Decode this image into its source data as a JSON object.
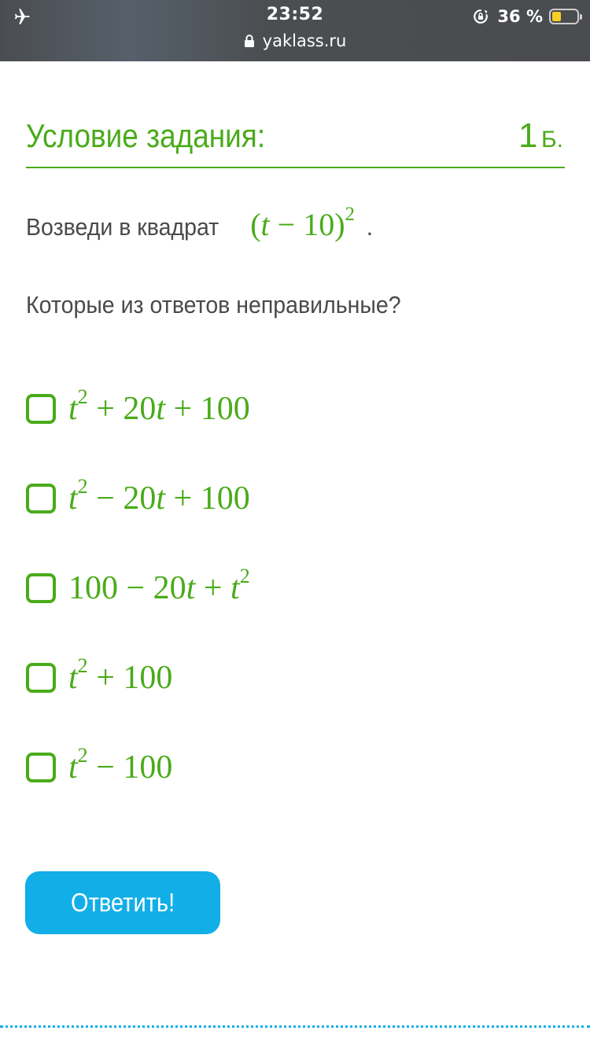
{
  "status_bar": {
    "time": "23:52",
    "battery_percent": "36 %",
    "battery_level": 0.36,
    "url": "yaklass.ru",
    "icons": [
      "airplane-icon",
      "rotation-lock-icon",
      "battery-icon",
      "padlock-icon"
    ]
  },
  "task": {
    "title": "Условие задания:",
    "points_value": "1",
    "points_unit": "Б."
  },
  "question": {
    "prompt": "Возведи в квадрат",
    "expression": {
      "open": "(",
      "var": "t",
      "rest": " − 10)",
      "power": "2"
    },
    "dot": ".",
    "instruction": "Которые из ответов неправильные?"
  },
  "options": [
    {
      "parts": [
        "t",
        "2",
        " + 20",
        "t",
        " + 100"
      ]
    },
    {
      "parts": [
        "t",
        "2",
        " − 20",
        "t",
        " + 100"
      ]
    },
    {
      "prefix": "100 − 20",
      "var": "t",
      "mid": " + ",
      "var2": "t",
      "power": "2"
    },
    {
      "parts": [
        "t",
        "2",
        " + 100"
      ]
    },
    {
      "parts": [
        "t",
        "2",
        " − 100"
      ]
    }
  ],
  "submit_label": "Ответить!",
  "colors": {
    "accent_green": "#4aab1a",
    "button_blue": "#12aee8",
    "text_gray": "#4a4a4a",
    "statusbar_bg": "#4a4c4f"
  }
}
